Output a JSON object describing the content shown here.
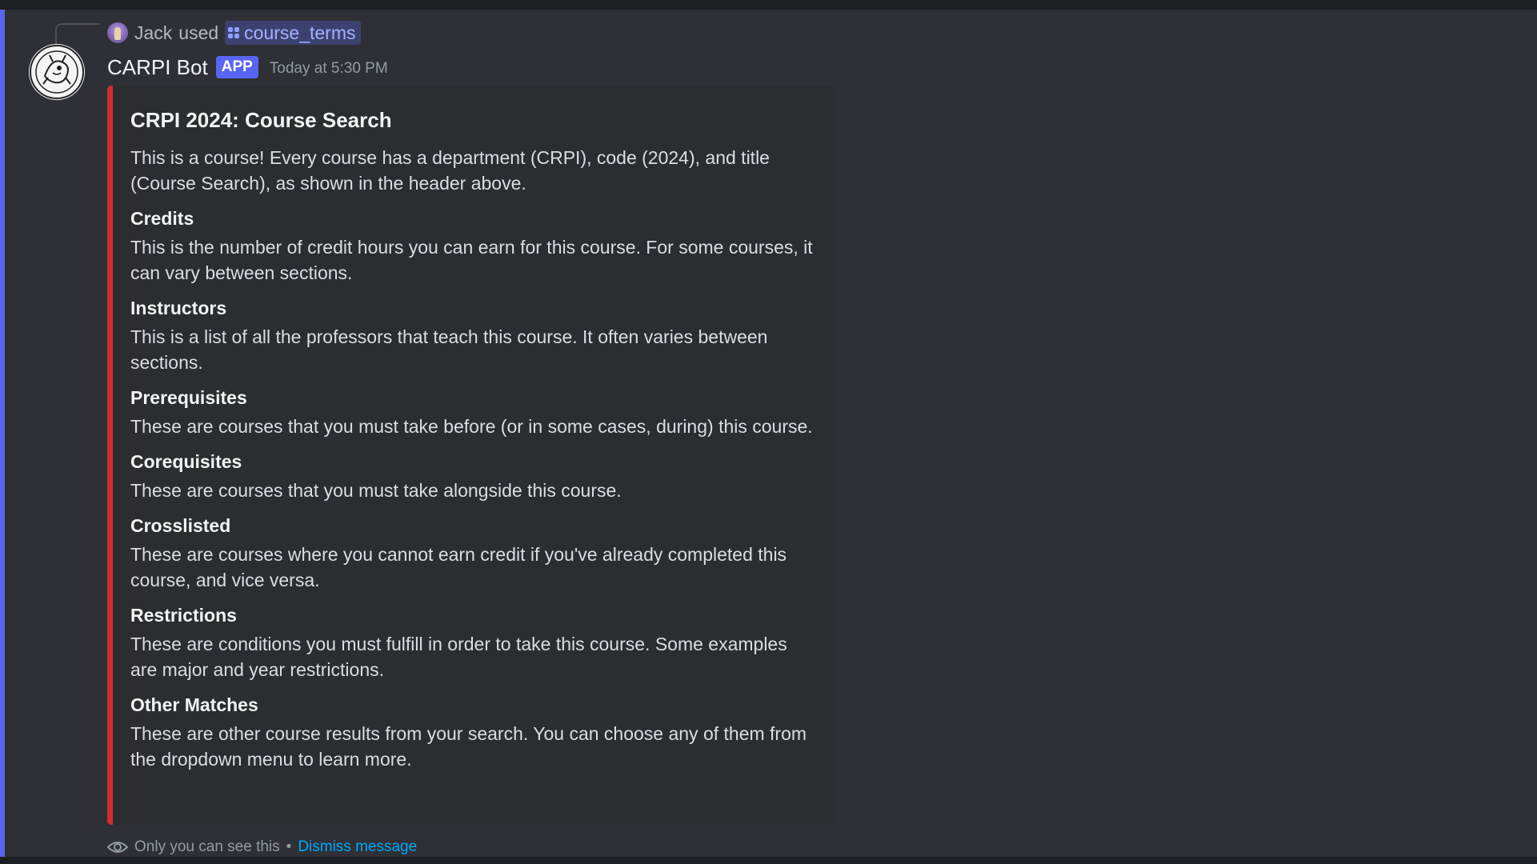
{
  "interaction": {
    "user": "Jack",
    "used_text": "used",
    "command": "course_terms"
  },
  "message": {
    "author": "CARPI Bot",
    "badge": "APP",
    "timestamp": "Today at 5:30 PM"
  },
  "embed": {
    "accent_color": "#d22e2e",
    "title": "CRPI 2024: Course Search",
    "description": "This is a course! Every course has a department (CRPI), code (2024), and title (Course Search), as shown in the header above.",
    "fields": [
      {
        "name": "Credits",
        "value": "This is the number of credit hours you can earn for this course. For some courses, it can vary between sections."
      },
      {
        "name": "Instructors",
        "value": "This is a list of all the professors that teach this course. It often varies between sections."
      },
      {
        "name": "Prerequisites",
        "value": "These are courses that you must take before (or in some cases, during) this course."
      },
      {
        "name": "Corequisites",
        "value": "These are courses that you must take alongside this course."
      },
      {
        "name": "Crosslisted",
        "value": "These are courses where you cannot earn credit if you've already completed this course, and vice versa."
      },
      {
        "name": "Restrictions",
        "value": "These are conditions you must fulfill in order to take this course. Some examples are major and year restrictions."
      },
      {
        "name": "Other Matches",
        "value": "These are other course results from your search. You can choose any of them from the dropdown menu to learn more."
      }
    ]
  },
  "footer": {
    "visibility_text": "Only you can see this",
    "separator": "•",
    "dismiss_label": "Dismiss message"
  },
  "colors": {
    "brand": "#5865f2",
    "link": "#00a8fc",
    "background": "#2e3035"
  }
}
